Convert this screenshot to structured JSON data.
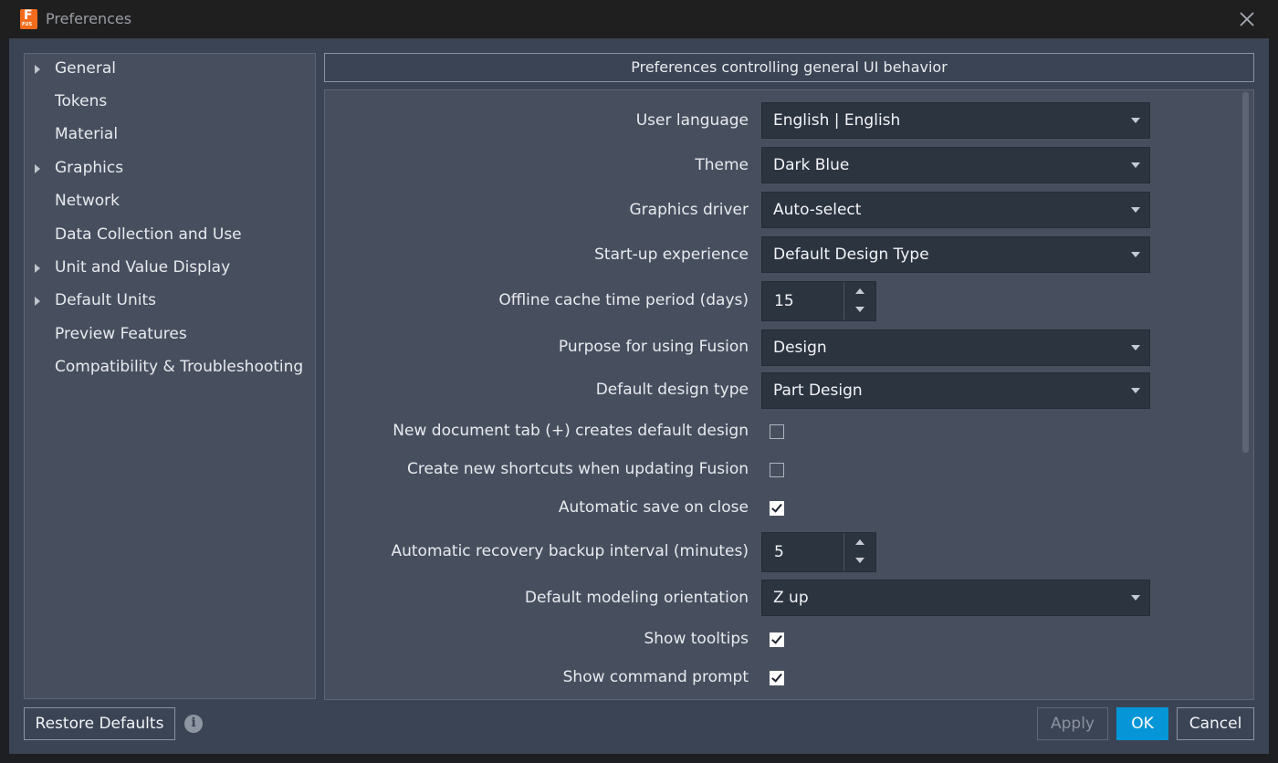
{
  "window": {
    "title": "Preferences",
    "app_badge": "F",
    "app_badge_sub": "FUS"
  },
  "sidebar": {
    "items": [
      {
        "label": "General",
        "expandable": true
      },
      {
        "label": "Tokens",
        "expandable": false
      },
      {
        "label": "Material",
        "expandable": false
      },
      {
        "label": "Graphics",
        "expandable": true
      },
      {
        "label": "Network",
        "expandable": false
      },
      {
        "label": "Data Collection and Use",
        "expandable": false
      },
      {
        "label": "Unit and Value Display",
        "expandable": true
      },
      {
        "label": "Default Units",
        "expandable": true
      },
      {
        "label": "Preview Features",
        "expandable": false
      },
      {
        "label": "Compatibility & Troubleshooting",
        "expandable": false
      }
    ]
  },
  "panel": {
    "header": "Preferences controlling general UI behavior",
    "rows": {
      "user_language": {
        "label": "User language",
        "value": "English | English"
      },
      "theme": {
        "label": "Theme",
        "value": "Dark Blue"
      },
      "graphics_driver": {
        "label": "Graphics driver",
        "value": "Auto-select"
      },
      "startup": {
        "label": "Start-up experience",
        "value": "Default Design Type"
      },
      "offline_cache": {
        "label": "Offline cache time period (days)",
        "value": "15"
      },
      "purpose": {
        "label": "Purpose for using Fusion",
        "value": "Design"
      },
      "design_type": {
        "label": "Default design type",
        "value": "Part Design"
      },
      "new_doc_tab": {
        "label": "New document tab (+) creates default design",
        "checked": false
      },
      "shortcuts": {
        "label": "Create new shortcuts when updating Fusion",
        "checked": false
      },
      "autosave": {
        "label": "Automatic save on close",
        "checked": true
      },
      "recovery": {
        "label": "Automatic recovery backup interval (minutes)",
        "value": "5"
      },
      "orientation": {
        "label": "Default modeling orientation",
        "value": "Z up"
      },
      "tooltips": {
        "label": "Show tooltips",
        "checked": true
      },
      "command_prompt": {
        "label": "Show command prompt",
        "checked": true
      }
    }
  },
  "footer": {
    "restore_label": "Restore Defaults",
    "info_glyph": "i",
    "apply_label": "Apply",
    "ok_label": "OK",
    "cancel_label": "Cancel"
  },
  "colors": {
    "accent": "#0696d7",
    "background": "#3b4455",
    "panel": "#474f5f",
    "field": "#2c3440"
  }
}
